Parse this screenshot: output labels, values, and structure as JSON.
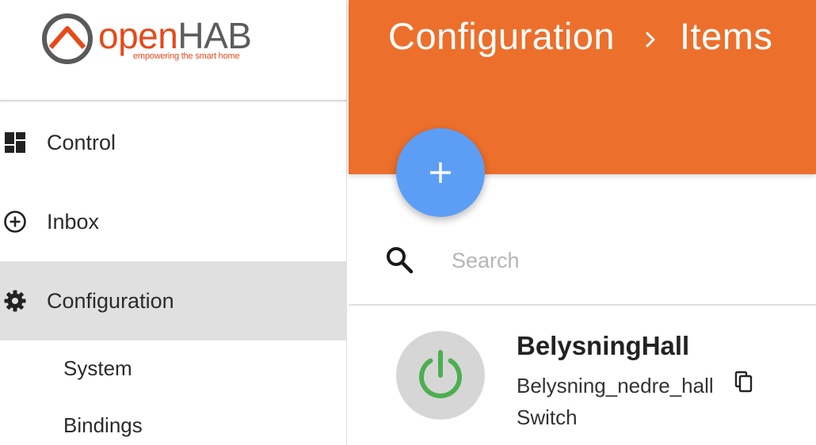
{
  "logo": {
    "brand_open": "open",
    "brand_hab": "HAB",
    "tagline": "empowering the smart home"
  },
  "sidebar": {
    "items": [
      {
        "label": "Control",
        "icon": "dashboard-icon",
        "active": false
      },
      {
        "label": "Inbox",
        "icon": "add-circle-icon",
        "active": false
      },
      {
        "label": "Configuration",
        "icon": "gear-icon",
        "active": true
      }
    ],
    "subitems": [
      {
        "label": "System"
      },
      {
        "label": "Bindings"
      }
    ]
  },
  "header": {
    "breadcrumb": [
      "Configuration",
      "Items"
    ],
    "color": "#ED6F2C"
  },
  "fab": {
    "icon": "plus-icon",
    "color": "#5C9EF5"
  },
  "search": {
    "placeholder": "Search",
    "value": "",
    "icon": "search-icon"
  },
  "items": [
    {
      "name": "BelysningHall",
      "label": "Belysning_nedre_hall",
      "type": "Switch",
      "icon": "power-icon",
      "icon_color": "#4CAF50"
    }
  ]
}
